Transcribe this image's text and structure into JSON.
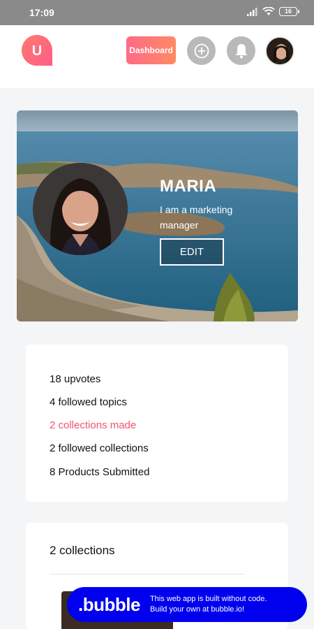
{
  "status_bar": {
    "time": "17:09",
    "battery": "16"
  },
  "header": {
    "logo_letter": "U",
    "dashboard_label": "Dashboard",
    "icons": [
      "plus-icon",
      "bell-icon",
      "avatar"
    ]
  },
  "profile": {
    "name": "MARIA",
    "bio": "I am a marketing manager",
    "edit_label": "EDIT"
  },
  "stats": {
    "items": [
      {
        "label": "18 upvotes",
        "active": false
      },
      {
        "label": "4 followed topics",
        "active": false
      },
      {
        "label": "2 collections made",
        "active": true
      },
      {
        "label": "2 followed collections",
        "active": false
      },
      {
        "label": "8 Products Submitted",
        "active": false
      }
    ]
  },
  "collections": {
    "title": "2 collections"
  },
  "banner": {
    "brand": ".bubble",
    "line1": "This web app is built without code.",
    "line2": "Build your own at bubble.io!"
  },
  "colors": {
    "accent": "#ef5470",
    "dashboard_gradient_start": "#ff6a88",
    "dashboard_gradient_end": "#ff8a63",
    "bubble_blue": "#0000ee"
  }
}
